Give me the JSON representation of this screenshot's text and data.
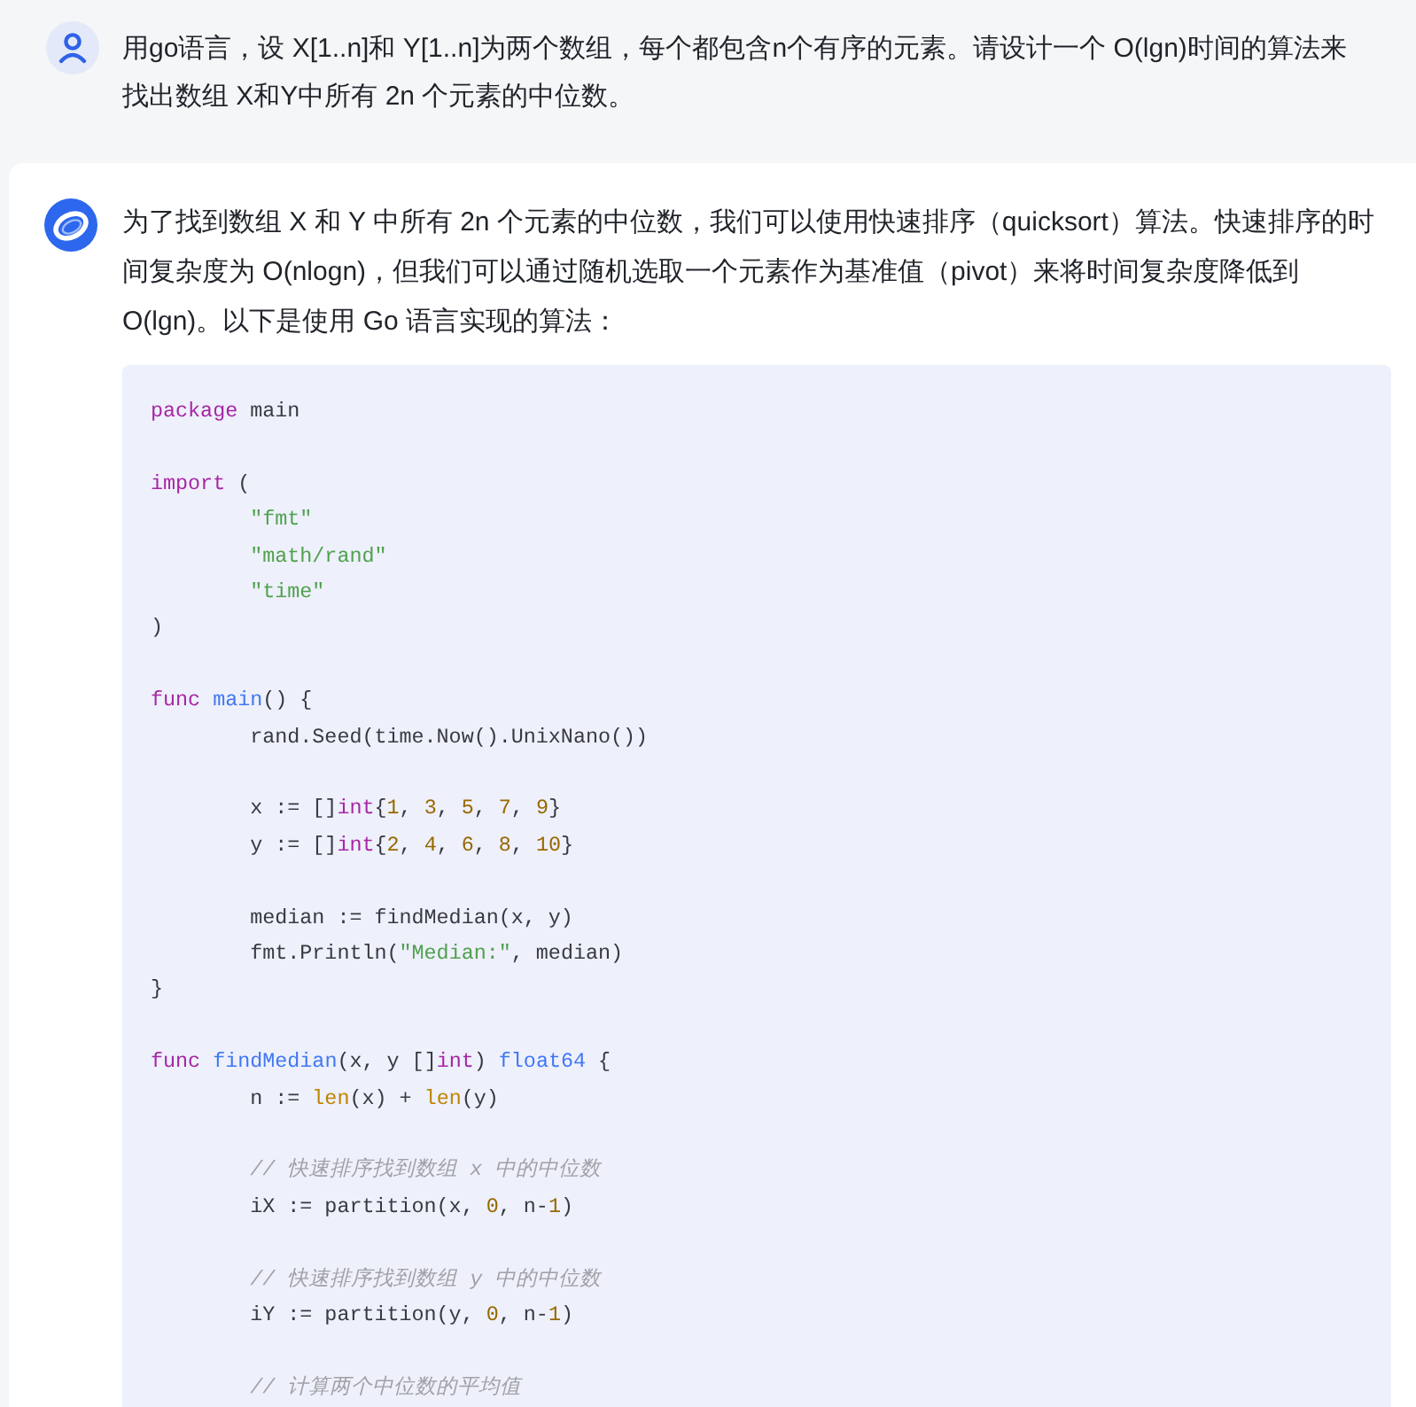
{
  "user_message": {
    "text": "用go语言，设 X[1..n]和 Y[1..n]为两个数组，每个都包含n个有序的元素。请设计一个 O(lgn)时间的算法来找出数组 X和Y中所有 2n 个元素的中位数。"
  },
  "assistant_message": {
    "paragraph": "为了找到数组 X 和 Y 中所有 2n 个元素的中位数，我们可以使用快速排序（quicksort）算法。快速排序的时间复杂度为 O(nlogn)，但我们可以通过随机选取一个元素作为基准值（pivot）来将时间复杂度降低到O(lgn)。以下是使用 Go 语言实现的算法：",
    "code_block": {
      "lines": [
        {
          "kind": "code",
          "segments": [
            {
              "kind": "keyword",
              "text": "package"
            },
            {
              "kind": "plain",
              "text": " main"
            }
          ]
        },
        {
          "kind": "blank"
        },
        {
          "kind": "code",
          "segments": [
            {
              "kind": "keyword",
              "text": "import"
            },
            {
              "kind": "plain",
              "text": " ("
            }
          ]
        },
        {
          "kind": "code",
          "segments": [
            {
              "kind": "string",
              "text": "\t\"fmt\""
            }
          ]
        },
        {
          "kind": "code",
          "segments": [
            {
              "kind": "string",
              "text": "\t\"math/rand\""
            }
          ]
        },
        {
          "kind": "code",
          "segments": [
            {
              "kind": "string",
              "text": "\t\"time\""
            }
          ]
        },
        {
          "kind": "code",
          "segments": [
            {
              "kind": "plain",
              "text": ")"
            }
          ]
        },
        {
          "kind": "blank"
        },
        {
          "kind": "code",
          "segments": [
            {
              "kind": "keyword",
              "text": "func"
            },
            {
              "kind": "title",
              "text": " main"
            },
            {
              "kind": "plain",
              "text": "() {"
            }
          ]
        },
        {
          "kind": "code",
          "segments": [
            {
              "kind": "plain",
              "text": "\trand.Seed(time.Now().UnixNano())"
            }
          ]
        },
        {
          "kind": "blank"
        },
        {
          "kind": "code",
          "segments": [
            {
              "kind": "plain",
              "text": "\tx := []"
            },
            {
              "kind": "keyword",
              "text": "int"
            },
            {
              "kind": "plain",
              "text": "{"
            },
            {
              "kind": "number",
              "text": "1"
            },
            {
              "kind": "plain",
              "text": ", "
            },
            {
              "kind": "number",
              "text": "3"
            },
            {
              "kind": "plain",
              "text": ", "
            },
            {
              "kind": "number",
              "text": "5"
            },
            {
              "kind": "plain",
              "text": ", "
            },
            {
              "kind": "number",
              "text": "7"
            },
            {
              "kind": "plain",
              "text": ", "
            },
            {
              "kind": "number",
              "text": "9"
            },
            {
              "kind": "plain",
              "text": "}"
            }
          ]
        },
        {
          "kind": "code",
          "segments": [
            {
              "kind": "plain",
              "text": "\ty := []"
            },
            {
              "kind": "keyword",
              "text": "int"
            },
            {
              "kind": "plain",
              "text": "{"
            },
            {
              "kind": "number",
              "text": "2"
            },
            {
              "kind": "plain",
              "text": ", "
            },
            {
              "kind": "number",
              "text": "4"
            },
            {
              "kind": "plain",
              "text": ", "
            },
            {
              "kind": "number",
              "text": "6"
            },
            {
              "kind": "plain",
              "text": ", "
            },
            {
              "kind": "number",
              "text": "8"
            },
            {
              "kind": "plain",
              "text": ", "
            },
            {
              "kind": "number",
              "text": "10"
            },
            {
              "kind": "plain",
              "text": "}"
            }
          ]
        },
        {
          "kind": "blank"
        },
        {
          "kind": "code",
          "segments": [
            {
              "kind": "plain",
              "text": "\tmedian := findMedian(x, y)"
            }
          ]
        },
        {
          "kind": "code",
          "segments": [
            {
              "kind": "plain",
              "text": "\tfmt.Println("
            },
            {
              "kind": "string",
              "text": "\"Median:\""
            },
            {
              "kind": "plain",
              "text": ", median)"
            }
          ]
        },
        {
          "kind": "code",
          "segments": [
            {
              "kind": "plain",
              "text": "}"
            }
          ]
        },
        {
          "kind": "blank"
        },
        {
          "kind": "code",
          "segments": [
            {
              "kind": "keyword",
              "text": "func"
            },
            {
              "kind": "title",
              "text": " findMedian"
            },
            {
              "kind": "plain",
              "text": "(x, y []"
            },
            {
              "kind": "keyword",
              "text": "int"
            },
            {
              "kind": "plain",
              "text": ") "
            },
            {
              "kind": "title",
              "text": "float64"
            },
            {
              "kind": "plain",
              "text": " {"
            }
          ]
        },
        {
          "kind": "code",
          "segments": [
            {
              "kind": "plain",
              "text": "\tn := "
            },
            {
              "kind": "builtin",
              "text": "len"
            },
            {
              "kind": "plain",
              "text": "(x) + "
            },
            {
              "kind": "builtin",
              "text": "len"
            },
            {
              "kind": "plain",
              "text": "(y)"
            }
          ]
        },
        {
          "kind": "blank"
        },
        {
          "kind": "code",
          "segments": [
            {
              "kind": "comment",
              "text": "\t// 快速排序找到数组 x 中的中位数"
            }
          ]
        },
        {
          "kind": "code",
          "segments": [
            {
              "kind": "plain",
              "text": "\tiX := partition(x, "
            },
            {
              "kind": "number",
              "text": "0"
            },
            {
              "kind": "plain",
              "text": ", n-"
            },
            {
              "kind": "number",
              "text": "1"
            },
            {
              "kind": "plain",
              "text": ")"
            }
          ]
        },
        {
          "kind": "blank"
        },
        {
          "kind": "code",
          "segments": [
            {
              "kind": "comment",
              "text": "\t// 快速排序找到数组 y 中的中位数"
            }
          ]
        },
        {
          "kind": "code",
          "segments": [
            {
              "kind": "plain",
              "text": "\tiY := partition(y, "
            },
            {
              "kind": "number",
              "text": "0"
            },
            {
              "kind": "plain",
              "text": ", n-"
            },
            {
              "kind": "number",
              "text": "1"
            },
            {
              "kind": "plain",
              "text": ")"
            }
          ]
        },
        {
          "kind": "blank"
        },
        {
          "kind": "code",
          "segments": [
            {
              "kind": "comment",
              "text": "\t// 计算两个中位数的平均值"
            }
          ]
        }
      ]
    }
  }
}
